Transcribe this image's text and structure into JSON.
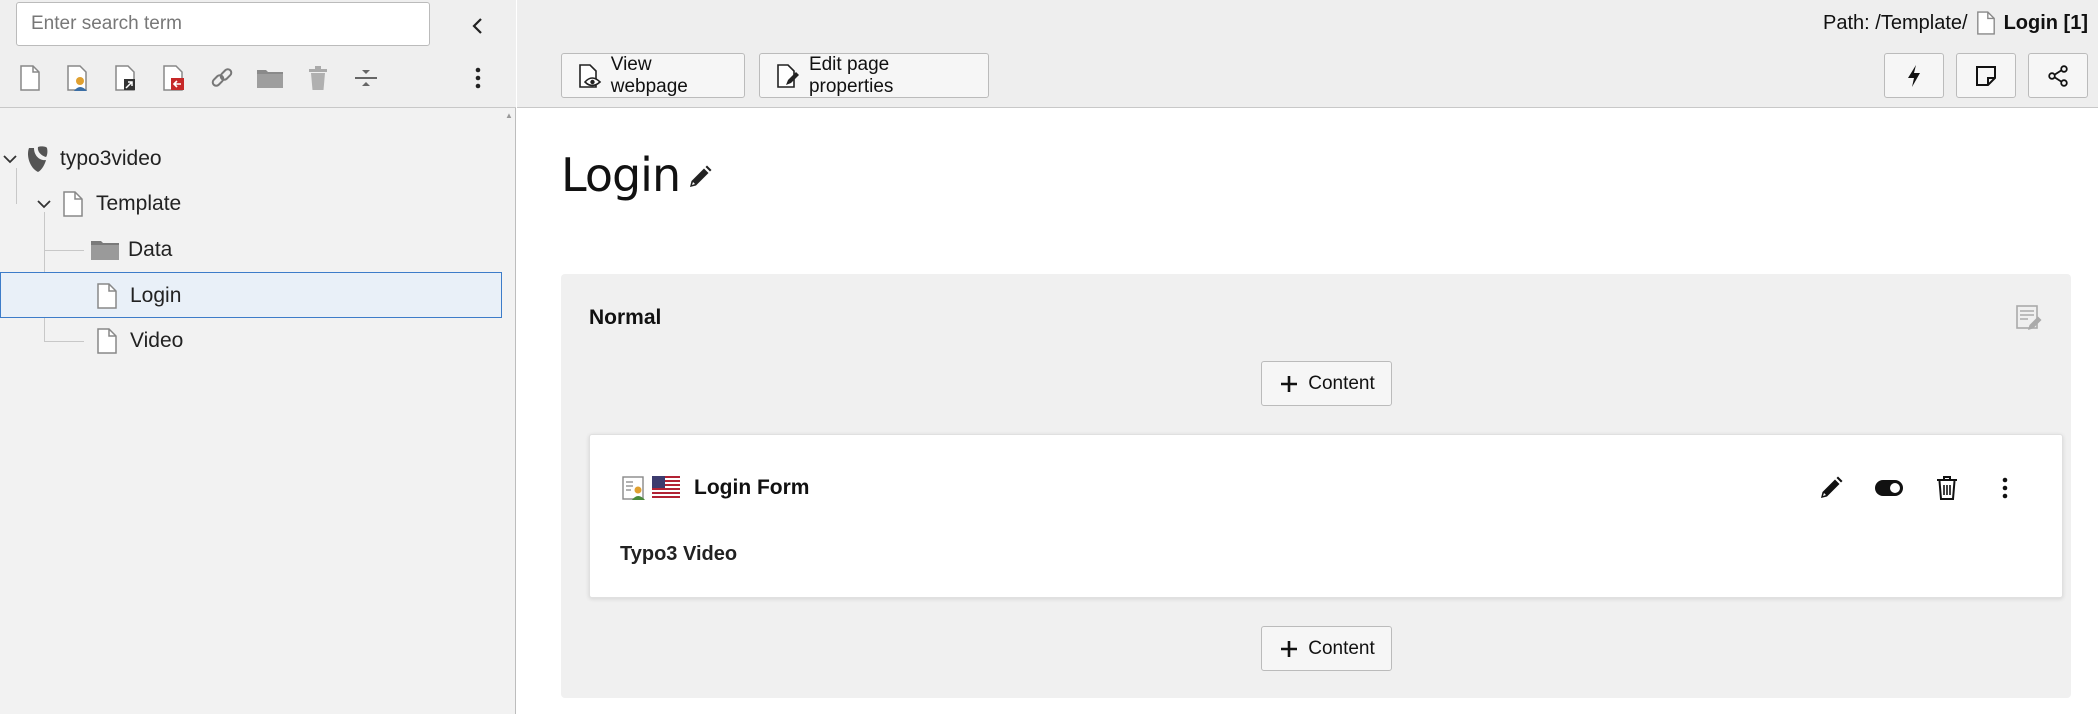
{
  "sidebar": {
    "search_placeholder": "Enter search term",
    "toolbar_icons": [
      "new-page-icon",
      "new-backend-user-page-icon",
      "new-shortcut-page-icon",
      "new-external-link-page-icon",
      "new-link-icon",
      "new-folder-icon",
      "new-recycler-icon",
      "new-spacer-icon"
    ],
    "tree": {
      "root": "typo3video",
      "template": "Template",
      "items": [
        "Data",
        "Login",
        "Video"
      ]
    }
  },
  "header": {
    "path_label": "Path: /Template/",
    "path_current": "Login [1]",
    "view_webpage": "View webpage",
    "edit_page_properties": "Edit page properties"
  },
  "page": {
    "title": "Login",
    "column_title": "Normal",
    "add_content_label": "Content",
    "element": {
      "title": "Login Form",
      "body": "Typo3 Video"
    }
  },
  "colors": {
    "selected_bg": "#e9f0f8",
    "selected_border": "#3d7cc9",
    "typo3_logo": "#555555",
    "flag_red": "#b22234",
    "flag_blue": "#3c3b6e",
    "red_icon": "#c62828"
  }
}
